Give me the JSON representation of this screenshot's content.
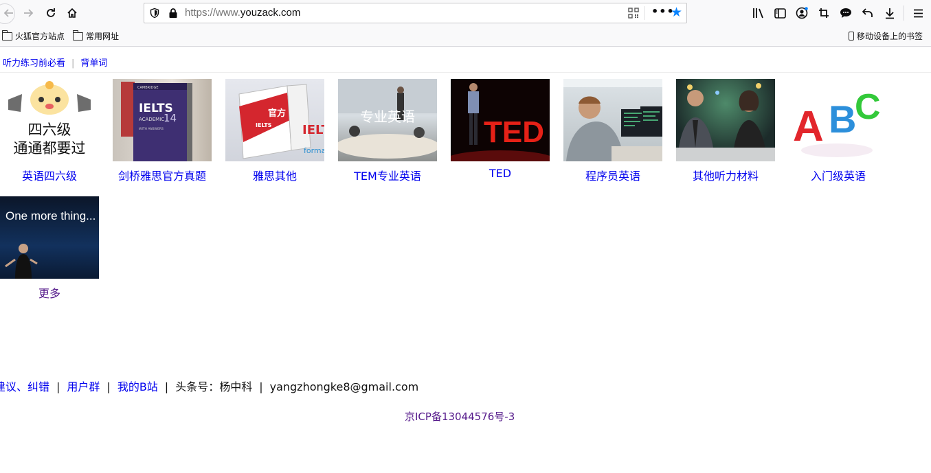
{
  "browser": {
    "url_prefix": "https://www.",
    "url_domain": "youzack.com",
    "bookmarks": [
      "火狐官方站点",
      "常用网址"
    ],
    "mobile_bookmarks": "移动设备上的书签",
    "accent": "#0a84ff"
  },
  "nav": {
    "must_read": "听力练习前必看",
    "separator": "|",
    "vocab": "背单词"
  },
  "tiles": [
    {
      "label": "英语四六级",
      "image_text": [
        "四六级",
        "通通都要过"
      ]
    },
    {
      "label": "剑桥雅思官方真题",
      "image_text": [
        "IELTS",
        "ACADEMIC",
        "14",
        "CAMBRIDGE",
        "WITH ANSWERS"
      ]
    },
    {
      "label": "雅思其他",
      "image_text": [
        "官方",
        "IELTS",
        "formatio"
      ]
    },
    {
      "label": "TEM专业英语",
      "image_text": [
        "专业英语"
      ]
    },
    {
      "label": "TED",
      "image_text": [
        "TED"
      ]
    },
    {
      "label": "程序员英语",
      "image_text": []
    },
    {
      "label": "其他听力材料",
      "image_text": []
    },
    {
      "label": "入门级英语",
      "image_text": [
        "A",
        "B",
        "C"
      ]
    },
    {
      "label": "更多",
      "image_text": [
        "One more thing..."
      ]
    }
  ],
  "footer": {
    "feedback": "建议、纠错",
    "user_group": "用户群",
    "bilibili": "我的B站",
    "toutiao": "头条号：杨中科",
    "email": "yangzhongke8@gmail.com",
    "pipe": "|",
    "icp": "京ICP备13044576号-3"
  }
}
